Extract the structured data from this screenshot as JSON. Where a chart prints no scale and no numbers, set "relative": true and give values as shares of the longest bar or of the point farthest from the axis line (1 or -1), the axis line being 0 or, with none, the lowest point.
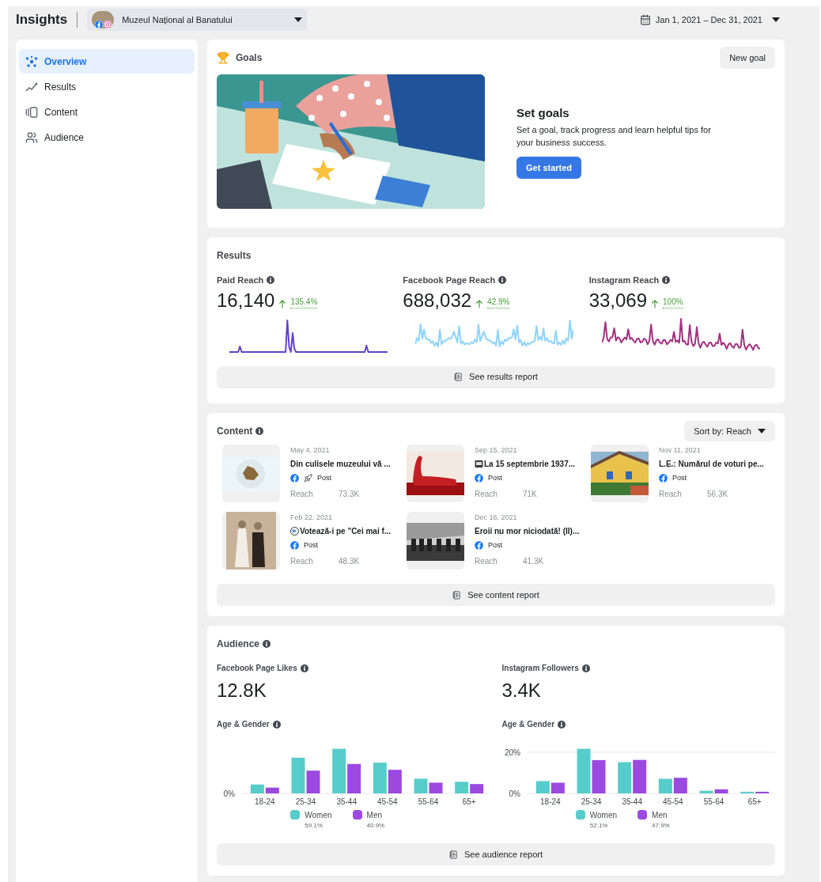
{
  "header": {
    "title": "Insights",
    "page_name": "Muzeul Național al Banatului",
    "date_range": "Jan 1, 2021 – Dec 31, 2021"
  },
  "sidebar": {
    "items": [
      {
        "label": "Overview",
        "selected": true
      },
      {
        "label": "Results",
        "selected": false
      },
      {
        "label": "Content",
        "selected": false
      },
      {
        "label": "Audience",
        "selected": false
      }
    ]
  },
  "goals": {
    "title": "Goals",
    "new_goal": "New goal",
    "heading": "Set goals",
    "description": "Set a goal, track progress and learn helpful tips for your business success.",
    "cta": "Get started"
  },
  "results": {
    "title": "Results",
    "report": "See results report",
    "metrics": [
      {
        "label": "Paid Reach",
        "value": "16,140",
        "change": "135.4%",
        "color": "#6441c9"
      },
      {
        "label": "Facebook Page Reach",
        "value": "688,032",
        "change": "42.9%",
        "color": "#8fd3fb"
      },
      {
        "label": "Instagram Reach",
        "value": "33,069",
        "change": "100%",
        "color": "#a3307f"
      }
    ]
  },
  "content": {
    "title": "Content",
    "sort": "Sort by: Reach",
    "report": "See content report",
    "posts": [
      {
        "kind": "boosted",
        "date": "May 4, 2021",
        "title": "Din culisele muzeului vă ...",
        "type": "Post",
        "reach_label": "Reach",
        "reach": "73.3K"
      },
      {
        "kind": "news",
        "date": "Sep 15, 2021",
        "title": "La 15 septembrie 1937...",
        "type": "Post",
        "reach_label": "Reach",
        "reach": "71K"
      },
      {
        "kind": "plain",
        "date": "Nov 11, 2021",
        "title": "L.E.: Numărul de voturi pe...",
        "type": "Post",
        "reach_label": "Reach",
        "reach": "56.3K"
      },
      {
        "kind": "poll",
        "date": "Feb 22, 2021",
        "title": "Votează-i pe \"Cei mai f...",
        "type": "Post",
        "reach_label": "Reach",
        "reach": "48.3K"
      },
      {
        "kind": "plain",
        "date": "Dec 16, 2021",
        "title": "Eroii nu mor niciodată! (II)...",
        "type": "Post",
        "reach_label": "Reach",
        "reach": "41.3K"
      }
    ]
  },
  "audience": {
    "title": "Audience",
    "report": "See audience report",
    "sections": [
      {
        "label": "Facebook Page Likes",
        "value": "12.8K",
        "chart_title": "Age & Gender",
        "shares": [
          "59.1%",
          "40.9%"
        ],
        "chart_data": {
          "type": "bar",
          "relative": true,
          "categories": [
            "18-24",
            "25-34",
            "35-44",
            "45-54",
            "55-64",
            "65+"
          ],
          "annotations": [
            "0%"
          ],
          "series": [
            {
              "name": "Women",
              "color": "#57cdcb",
              "values": [
                0.2,
                0.8,
                1,
                0.69,
                0.33,
                0.26
              ]
            },
            {
              "name": "Men",
              "color": "#9b49e0",
              "values": [
                0.13,
                0.51,
                0.66,
                0.53,
                0.24,
                0.21
              ]
            }
          ]
        }
      },
      {
        "label": "Instagram Followers",
        "value": "3.4K",
        "chart_title": "Age & Gender",
        "shares": [
          "52.1%",
          "47.9%"
        ],
        "chart_data": {
          "type": "bar",
          "categories": [
            "18-24",
            "25-34",
            "35-44",
            "45-54",
            "55-64",
            "65+"
          ],
          "ylim": [
            0,
            21.7
          ],
          "yticks": [
            {
              "value": 0,
              "label": "0%"
            },
            {
              "value": 20,
              "label": "20%"
            }
          ],
          "series": [
            {
              "name": "Women",
              "color": "#57cdcb",
              "values": [
                6.0,
                21.7,
                15.2,
                7.1,
                1.3,
                0.8
              ]
            },
            {
              "name": "Men",
              "color": "#9b49e0",
              "values": [
                5.2,
                16.2,
                16.3,
                7.6,
                2.0,
                0.8
              ]
            }
          ]
        }
      }
    ]
  }
}
